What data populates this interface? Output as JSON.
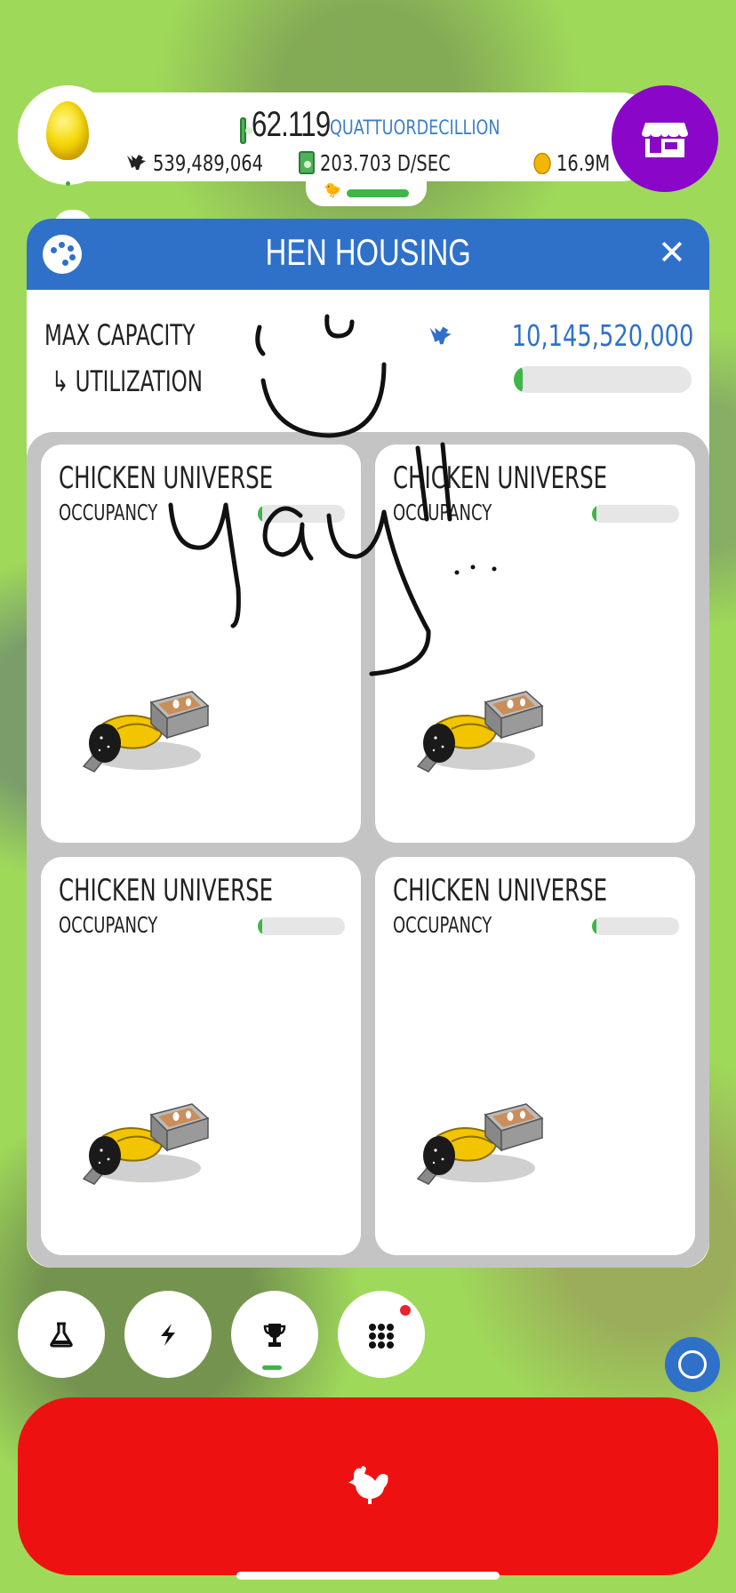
{
  "header": {
    "money_amount": "62.119",
    "money_unit": "QUATTUORDECILLION",
    "chickens": "539,489,064",
    "income_rate": "203.703 D/SEC",
    "golden_eggs": "16.9M",
    "hatch_progress": 0.5
  },
  "panel": {
    "title": "HEN HOUSING",
    "max_capacity_label": "MAX CAPACITY",
    "utilization_label": "↳ UTILIZATION",
    "max_capacity_value": "10,145,520,000",
    "utilization": 0.05
  },
  "habitats": [
    {
      "name": "CHICKEN UNIVERSE",
      "occupancy_label": "OCCUPANCY",
      "occupancy": 0.05
    },
    {
      "name": "CHICKEN UNIVERSE",
      "occupancy_label": "OCCUPANCY",
      "occupancy": 0.05
    },
    {
      "name": "CHICKEN UNIVERSE",
      "occupancy_label": "OCCUPANCY",
      "occupancy": 0.05
    },
    {
      "name": "CHICKEN UNIVERSE",
      "occupancy_label": "OCCUPANCY",
      "occupancy": 0.05
    }
  ],
  "drawing": {
    "text": "yay!!.."
  },
  "bottom_nav": {
    "buttons": [
      "research-icon",
      "boost-icon",
      "trophy-icon",
      "menu-grid-icon"
    ],
    "menu_has_notification": true
  },
  "colors": {
    "header_blue": "#2f71c9",
    "shop_purple": "#8a06c9",
    "hatch_red": "#ee1111",
    "progress_green": "#3fb54a"
  }
}
